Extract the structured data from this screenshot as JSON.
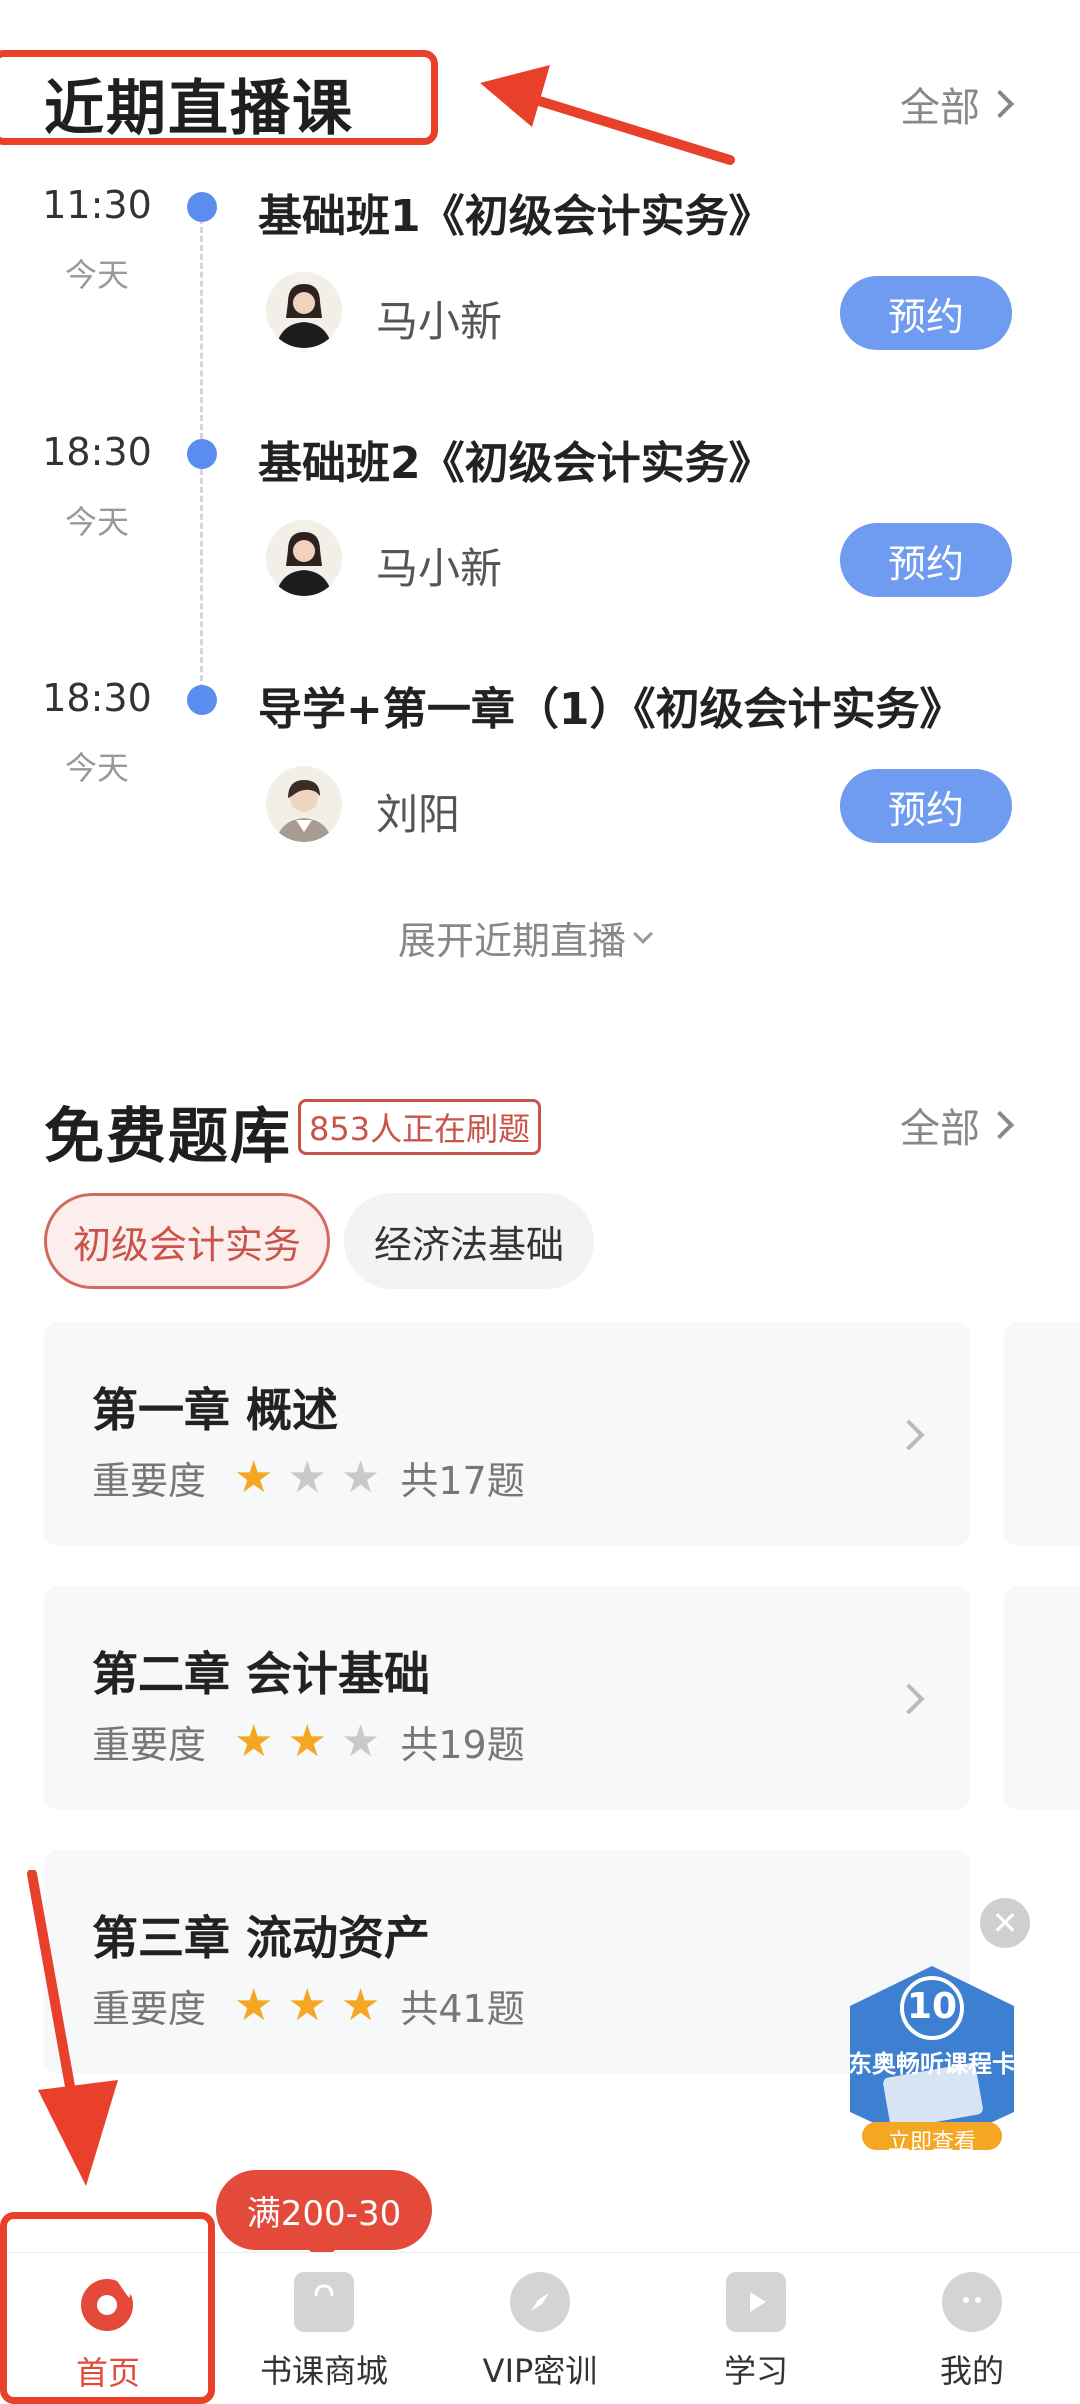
{
  "live": {
    "title": "近期直播课",
    "all_label": "全部",
    "items": [
      {
        "time": "11:30",
        "day": "今天",
        "title": "基础班1《初级会计实务》",
        "teacher": "马小新",
        "button": "预约"
      },
      {
        "time": "18:30",
        "day": "今天",
        "title": "基础班2《初级会计实务》",
        "teacher": "马小新",
        "button": "预约"
      },
      {
        "time": "18:30",
        "day": "今天",
        "title": "导学+第一章（1）《初级会计实务》",
        "teacher": "刘阳",
        "button": "预约"
      }
    ],
    "expand_label": "展开近期直播"
  },
  "bank": {
    "title": "免费题库",
    "badge": "853人正在刷题",
    "all_label": "全部",
    "tabs": [
      "初级会计实务",
      "经济法基础"
    ],
    "chapters": [
      {
        "title": "第一章 概述",
        "importance_label": "重要度",
        "stars": 1,
        "count": "共17题"
      },
      {
        "title": "第二章 会计基础",
        "importance_label": "重要度",
        "stars": 2,
        "count": "共19题"
      },
      {
        "title": "第三章 流动资产",
        "importance_label": "重要度",
        "stars": 3,
        "count": "共41题"
      }
    ]
  },
  "ad": {
    "number": "10",
    "title": "东奥畅听课程卡",
    "button": "立即查看"
  },
  "promo": "满200-30",
  "tabbar": [
    {
      "label": "首页",
      "icon": "home-icon",
      "active": true
    },
    {
      "label": "书课商城",
      "icon": "shopping-bag-icon",
      "active": false
    },
    {
      "label": "VIP密训",
      "icon": "compass-icon",
      "active": false
    },
    {
      "label": "学习",
      "icon": "play-icon",
      "active": false
    },
    {
      "label": "我的",
      "icon": "profile-icon",
      "active": false
    }
  ],
  "colors": {
    "accent": "#e34a3a",
    "button_blue": "#6f9cf0",
    "star": "#f5a623"
  }
}
